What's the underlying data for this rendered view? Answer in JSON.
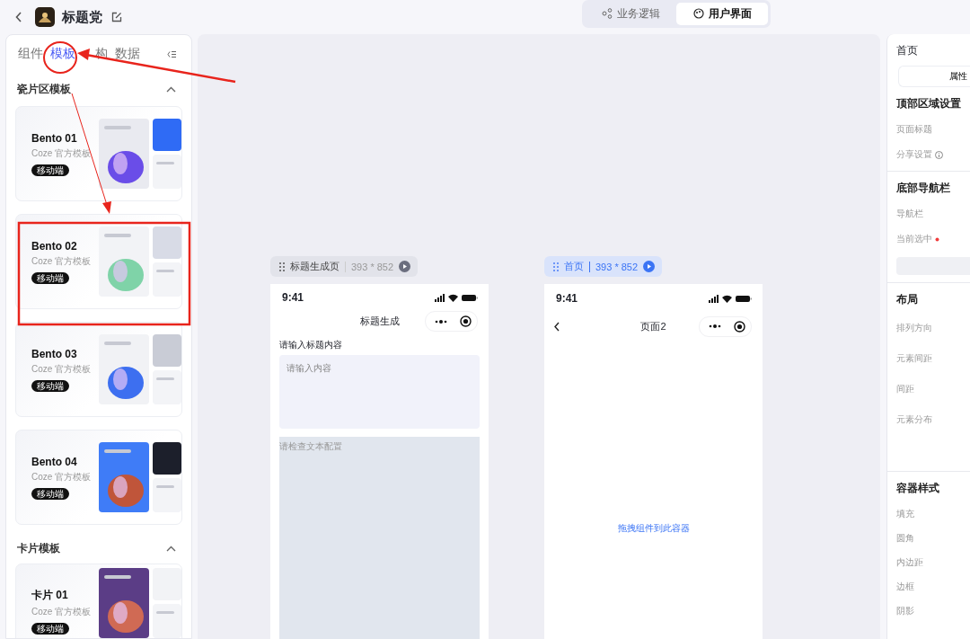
{
  "header": {
    "title": "标题党"
  },
  "mode_tabs": [
    {
      "label": "业务逻辑",
      "selected": false
    },
    {
      "label": "用户界面",
      "selected": true
    }
  ],
  "left_panel": {
    "tabs": [
      {
        "label": "组件",
        "selected": false
      },
      {
        "label": "模板",
        "selected": true
      },
      {
        "label": "构",
        "selected": false
      },
      {
        "label": "数据",
        "selected": false
      }
    ],
    "sections": [
      {
        "title": "瓷片区模板",
        "expanded": true,
        "templates": [
          {
            "name": "Bento 01",
            "subtitle": "Coze 官方模板",
            "badge": "移动端"
          },
          {
            "name": "Bento 02",
            "subtitle": "Coze 官方模板",
            "badge": "移动端"
          },
          {
            "name": "Bento 03",
            "subtitle": "Coze 官方模板",
            "badge": "移动端"
          },
          {
            "name": "Bento 04",
            "subtitle": "Coze 官方模板",
            "badge": "移动端"
          }
        ]
      },
      {
        "title": "卡片模板",
        "expanded": true,
        "templates": [
          {
            "name": "卡片 01",
            "subtitle": "Coze 官方模板",
            "badge": "移动端"
          }
        ]
      }
    ]
  },
  "canvas": {
    "pages": [
      {
        "kind": "form",
        "name": "标题生成页",
        "size": "393 * 852",
        "selected": false,
        "time": "9:41",
        "nav_title": "标题生成",
        "back": false,
        "label": "请输入标题内容",
        "placeholder": "请输入内容",
        "notice": "请检查文本配置"
      },
      {
        "kind": "empty",
        "name": "首页",
        "size": "393 * 852",
        "selected": true,
        "time": "9:41",
        "nav_title": "页面2",
        "back": true,
        "drop_hint": "拖拽组件到此容器"
      }
    ]
  },
  "right_panel": {
    "title": "首页",
    "tab": "属性",
    "sections": [
      {
        "title": "顶部区域设置",
        "select": false,
        "fields": [
          {
            "label": "页面标题",
            "info": false,
            "required": false
          },
          {
            "label": "分享设置",
            "info": true,
            "required": false
          }
        ]
      },
      {
        "title": "底部导航栏",
        "select": true,
        "fields": [
          {
            "label": "导航栏",
            "info": false,
            "required": false
          },
          {
            "label": "当前选中",
            "info": false,
            "required": true
          }
        ]
      },
      {
        "title": "布局",
        "select": false,
        "fields": [
          {
            "label": "排列方向",
            "info": false,
            "required": false
          },
          {
            "label": "元素间距",
            "info": false,
            "required": false
          },
          {
            "label": "间距",
            "info": false,
            "required": false
          },
          {
            "label": "元素分布",
            "info": false,
            "required": false
          }
        ]
      },
      {
        "title": "容器样式",
        "select": false,
        "fields": [
          {
            "label": "填充",
            "info": false,
            "required": false
          },
          {
            "label": "圆角",
            "info": false,
            "required": false
          },
          {
            "label": "内边距",
            "info": false,
            "required": false
          },
          {
            "label": "边框",
            "info": false,
            "required": false
          },
          {
            "label": "阴影",
            "info": false,
            "required": false
          }
        ]
      }
    ]
  }
}
